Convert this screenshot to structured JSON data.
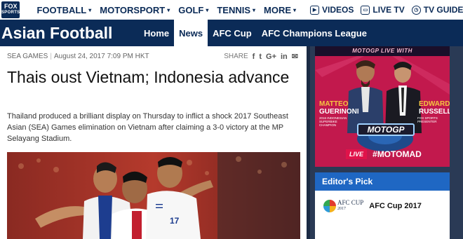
{
  "logo": {
    "line1": "FOX",
    "line2": "SPORTS"
  },
  "nav": {
    "items": [
      {
        "label": "FOOTBALL"
      },
      {
        "label": "MOTORSPORT"
      },
      {
        "label": "GOLF"
      },
      {
        "label": "TENNIS"
      },
      {
        "label": "MORE"
      }
    ],
    "caret": "▾"
  },
  "utility": {
    "videos": "VIDEOS",
    "live_tv": "LIVE TV",
    "tv_guide": "TV GUIDE"
  },
  "section": {
    "title": "Asian Football",
    "tabs": [
      {
        "label": "Home",
        "active": false
      },
      {
        "label": "News",
        "active": true
      },
      {
        "label": "AFC Cup",
        "active": false
      },
      {
        "label": "AFC Champions League",
        "active": false
      }
    ]
  },
  "article": {
    "category": "SEA GAMES",
    "date": "August 24, 2017 7:09 PM HKT",
    "share_label": "SHARE",
    "share_icons": [
      "f",
      "t",
      "G+",
      "in",
      "✉"
    ],
    "headline": "Thais oust Vietnam; Indonesia advance",
    "lead": "Thailand produced a brilliant display on Thursday to inflict a shock 2017 Southeast Asian (SEA) Games elimination on Vietnam after claiming a 3-0 victory at the MP Selayang Stadium."
  },
  "ad": {
    "top": "MOTOGP LIVE WITH",
    "host1_first": "MATTEO",
    "host1_last": "GUERINONI",
    "host1_sub": "2016 INDONESIAN SUPERBIKE CHAMPION",
    "host2_first": "EDWARD",
    "host2_last": "RUSSELL",
    "host2_sub": "FOX SPORTS PRESENTER",
    "motogp": "MOTOGP",
    "live": "LIVE",
    "hashtag": "#MOTOMAD"
  },
  "editors_pick": {
    "heading": "Editor's Pick",
    "logo_text": "AFC CUP",
    "logo_year": "2017",
    "title": "AFC Cup 2017"
  },
  "colors": {
    "brand": "#0b2b57",
    "accent": "#1f67c3",
    "ad": "#c2194d"
  }
}
